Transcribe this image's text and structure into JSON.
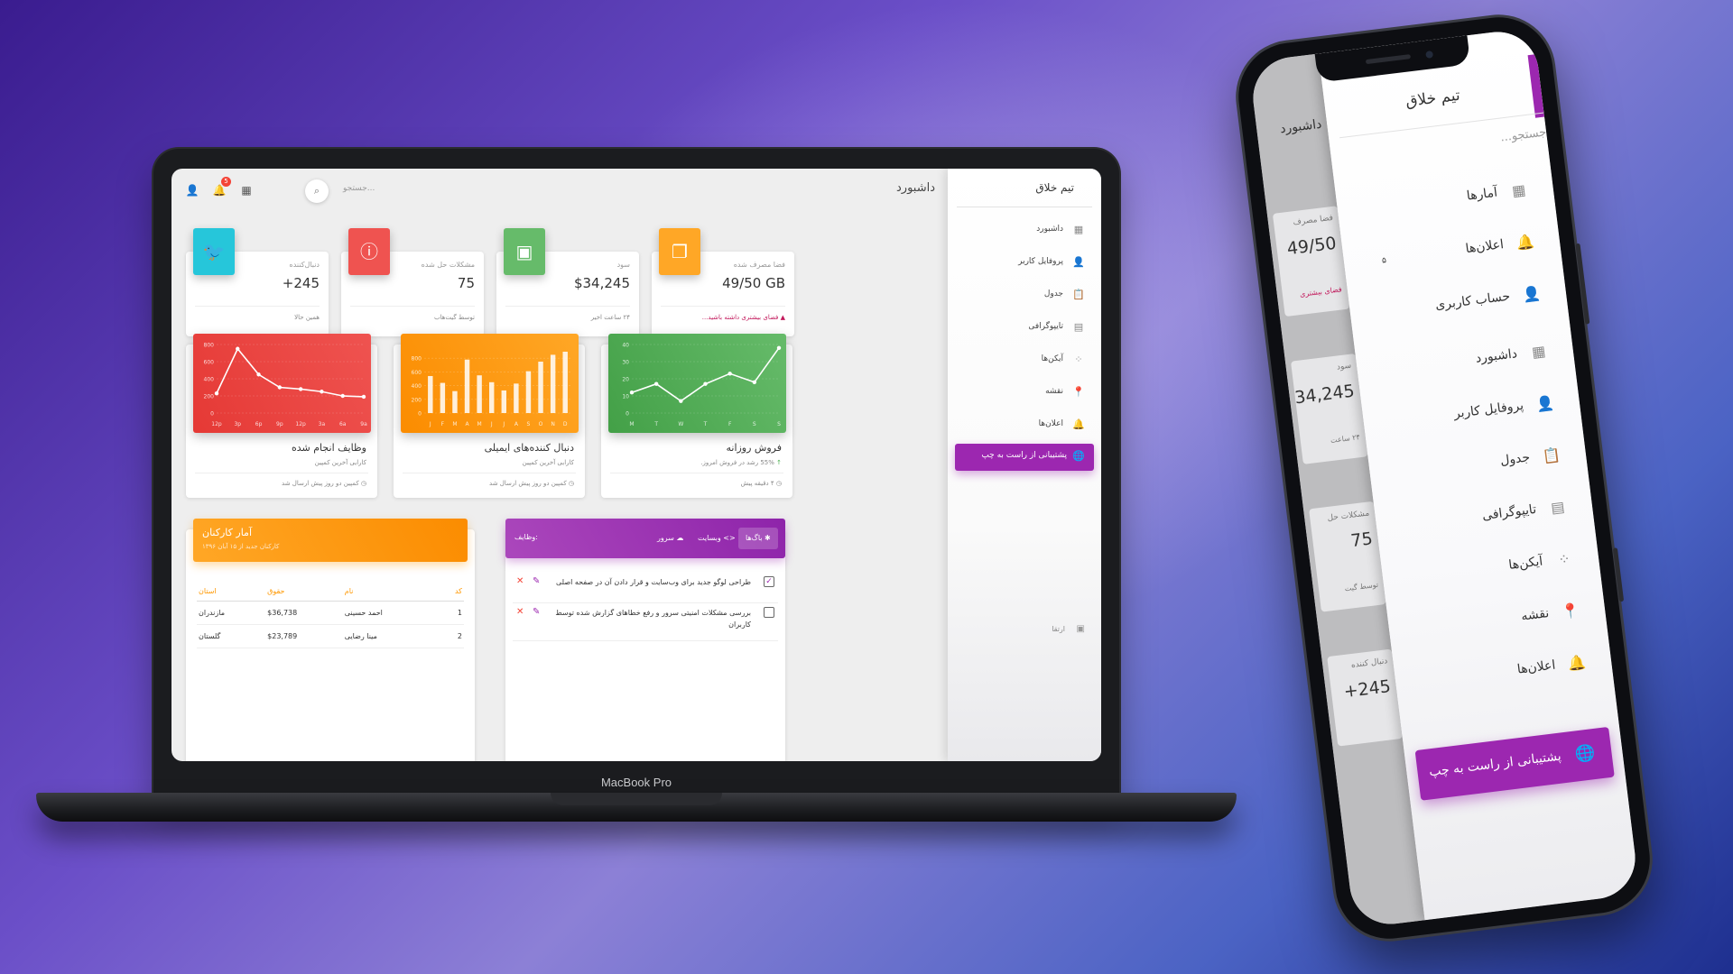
{
  "colors": {
    "twitter": "#26c6da",
    "red": "#ef5350",
    "green": "#66bb6a",
    "orange": "#ffa726",
    "purple": "#9c27b0"
  },
  "laptop": {
    "brand": "MacBook Pro",
    "topbar": {
      "title": "داشبورد",
      "search_placeholder": "جستجو...",
      "notification_count": "5"
    },
    "stats": [
      {
        "category": "دنبال‌کننده",
        "value": "+245",
        "footer": "همین حالا",
        "color": "#26c6da",
        "icon": "twitter-icon"
      },
      {
        "category": "مشکلات حل شده",
        "value": "75",
        "footer": "توسط گیت‌هاب",
        "color": "#ef5350",
        "icon": "info-icon"
      },
      {
        "category": "سود",
        "value": "$34,245",
        "footer": "۲۴ ساعت اخیر",
        "color": "#66bb6a",
        "icon": "store-icon"
      },
      {
        "category": "فضا مصرف شده",
        "value": "49/50 GB",
        "footer": "فضای بیشتری داشته باشید...",
        "color": "#ffa726",
        "icon": "copy-icon"
      }
    ],
    "charts": [
      {
        "title": "وظایف انجام شده",
        "subtitle": "کارایی آخرین کمپین",
        "footer": "کمپین دو روز پیش ارسال شد",
        "chart_data": {
          "type": "line",
          "categories": [
            "12p",
            "3p",
            "6p",
            "9p",
            "12p",
            "3a",
            "6a",
            "9a"
          ],
          "values": [
            230,
            750,
            450,
            300,
            280,
            250,
            200,
            190
          ],
          "ylim": [
            0,
            800
          ],
          "yticks": [
            0,
            200,
            400,
            600,
            800
          ],
          "color": "#ef5350"
        }
      },
      {
        "title": "دنبال کننده‌های ایمیلی",
        "subtitle": "کارایی آخرین کمپین",
        "footer": "کمپین دو روز پیش ارسال شد",
        "chart_data": {
          "type": "bar",
          "categories": [
            "J",
            "F",
            "M",
            "A",
            "M",
            "J",
            "J",
            "A",
            "S",
            "O",
            "N",
            "D"
          ],
          "values": [
            540,
            440,
            320,
            780,
            550,
            450,
            330,
            430,
            610,
            750,
            850,
            895
          ],
          "ylim": [
            0,
            1000
          ],
          "yticks": [
            0,
            200,
            400,
            600,
            800
          ],
          "color": "#ffa726"
        }
      },
      {
        "title": "فروش روزانه",
        "subtitle": "55% رشد در فروش امروز.",
        "subtitle_up": "55%",
        "footer": "۴ دقیقه پیش",
        "chart_data": {
          "type": "line",
          "categories": [
            "M",
            "T",
            "W",
            "T",
            "F",
            "S",
            "S"
          ],
          "values": [
            12,
            17,
            7,
            17,
            23,
            18,
            38
          ],
          "ylim": [
            0,
            40
          ],
          "yticks": [
            0,
            10,
            20,
            30,
            40
          ],
          "color": "#66bb6a"
        }
      }
    ],
    "employees": {
      "title": "آمار کارکنان",
      "subtitle": "کارکنان جدید از ۱۵ آبان ۱۳۹۶",
      "columns": [
        "کد",
        "نام",
        "حقوق",
        "استان"
      ],
      "rows": [
        [
          "1",
          "احمد حسینی",
          "$36,738",
          "مازندران"
        ],
        [
          "2",
          "مینا رضایی",
          "$23,789",
          "گلستان"
        ]
      ]
    },
    "tasks": {
      "label": "وظایف:",
      "tabs": [
        "باگ‌ها",
        "وبسایت",
        "سرور"
      ],
      "rows": [
        {
          "text": "طراحی لوگو جدید برای وب‌سایت و قرار دادن آن در صفحه اصلی",
          "checked": true
        },
        {
          "text": "بررسی مشکلات امنیتی سرور و رفع خطاهای گزارش شده توسط کاربران",
          "checked": false
        }
      ]
    },
    "sidebar": {
      "brand": "تیم خلاق",
      "items": [
        {
          "label": "داشبورد",
          "icon": "dashboard-icon"
        },
        {
          "label": "پروفایل کاربر",
          "icon": "person-icon"
        },
        {
          "label": "جدول",
          "icon": "clipboard-icon"
        },
        {
          "label": "تایپوگرافی",
          "icon": "library-icon"
        },
        {
          "label": "آیکن‌ها",
          "icon": "bubbles-icon"
        },
        {
          "label": "نقشه",
          "icon": "location-icon"
        },
        {
          "label": "اعلان‌ها",
          "icon": "bell-icon"
        }
      ],
      "cta": "پشتیبانی از راست به چپ",
      "bottom_label": "ارتقا"
    }
  },
  "phone": {
    "brand": "تیم خلاق",
    "search_placeholder": "جستجو...",
    "left_title": "داشبورد",
    "mini_cards": [
      {
        "category": "فضا مصرف",
        "value": "49/50",
        "footer": "فضای بیشتری"
      },
      {
        "category": "سود",
        "value": "34,245",
        "footer": "۲۴ ساعت"
      },
      {
        "category": "مشکلات حل",
        "value": "75",
        "footer": "توسط گیت"
      },
      {
        "category": "دنبال کننده",
        "value": "+245",
        "footer": ""
      }
    ],
    "items": [
      {
        "label": "آمارها",
        "icon": "dashboard-icon"
      },
      {
        "label": "اعلان‌ها",
        "icon": "bell-icon",
        "badge": "۵"
      },
      {
        "label": "حساب کاربری",
        "icon": "person-icon"
      },
      {
        "label": "داشبورد",
        "icon": "dashboard-icon"
      },
      {
        "label": "پروفایل کاربر",
        "icon": "person-icon"
      },
      {
        "label": "جدول",
        "icon": "clipboard-icon"
      },
      {
        "label": "تایپوگرافی",
        "icon": "library-icon"
      },
      {
        "label": "آیکن‌ها",
        "icon": "bubbles-icon"
      },
      {
        "label": "نقشه",
        "icon": "location-icon"
      },
      {
        "label": "اعلان‌ها",
        "icon": "bell-icon"
      }
    ],
    "cta": "پشتیبانی از راست به چپ"
  }
}
